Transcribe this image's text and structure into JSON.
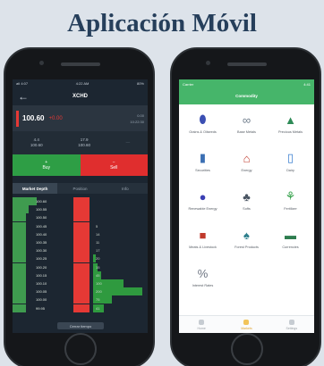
{
  "page_title": "Aplicación Móvil",
  "trade_screen": {
    "status_left": "atl 4:07",
    "status_time": "4:22 AM",
    "status_right": "80%",
    "ticker": "XCHD",
    "price": "100.60",
    "change": "+0.00",
    "price_meta_1": "0.00",
    "price_meta_2": "10:22:30",
    "stat_1_label": "4.4",
    "stat_1_value": "100.60",
    "stat_2_label": "17.9",
    "stat_2_value": "100.60",
    "buy_label": "Buy",
    "sell_label": "Sell",
    "tabs": [
      "Market Depth",
      "Position",
      "Info"
    ],
    "depth_rows": [
      {
        "bid": "100.60",
        "ask": "",
        "bid_fill": 0.18,
        "ask_fill": 0.0
      },
      {
        "bid": "100.55",
        "ask": "",
        "bid_fill": 0.12,
        "ask_fill": 0.0
      },
      {
        "bid": "100.50",
        "ask": "",
        "bid_fill": 0.1,
        "ask_fill": 0.0
      },
      {
        "bid": "100.45",
        "ask": "5",
        "bid_fill": 0.1,
        "ask_fill": 0.0
      },
      {
        "bid": "100.40",
        "ask": "14",
        "bid_fill": 0.1,
        "ask_fill": 0.0
      },
      {
        "bid": "100.35",
        "ask": "11",
        "bid_fill": 0.1,
        "ask_fill": 0.0
      },
      {
        "bid": "100.30",
        "ask": "17",
        "bid_fill": 0.1,
        "ask_fill": 0.0
      },
      {
        "bid": "100.25",
        "ask": "20",
        "bid_fill": 0.1,
        "ask_fill": 0.05
      },
      {
        "bid": "100.20",
        "ask": "15",
        "bid_fill": 0.1,
        "ask_fill": 0.08
      },
      {
        "bid": "100.15",
        "ask": "45",
        "bid_fill": 0.1,
        "ask_fill": 0.15
      },
      {
        "bid": "100.10",
        "ask": "100",
        "bid_fill": 0.1,
        "ask_fill": 0.55
      },
      {
        "bid": "100.05",
        "ask": "200",
        "bid_fill": 0.1,
        "ask_fill": 0.9
      },
      {
        "bid": "100.00",
        "ask": "75",
        "bid_fill": 0.1,
        "ask_fill": 0.35
      },
      {
        "bid": "99.95",
        "ask": "41",
        "bid_fill": 0.1,
        "ask_fill": 0.2
      }
    ],
    "close_button": "Cerrar tiempo"
  },
  "category_screen": {
    "status_left": "Carrier",
    "status_right": "4:41",
    "header_title": "Commodity",
    "categories": [
      {
        "label": "Grains & Oilseeds",
        "icon": "grain-icon",
        "color": "#3b4fb3"
      },
      {
        "label": "Base Metals",
        "icon": "chain-icon",
        "color": "#6f7d8c"
      },
      {
        "label": "Precious Metals",
        "icon": "gold-bars-icon",
        "color": "#2e8b57"
      },
      {
        "label": "Securities",
        "icon": "bar-chart-icon",
        "color": "#3b6fb3"
      },
      {
        "label": "Energy",
        "icon": "factory-icon",
        "color": "#c0392b"
      },
      {
        "label": "Dairy",
        "icon": "milk-icon",
        "color": "#3b7fd0"
      },
      {
        "label": "Renewable Energy",
        "icon": "leaf-drop-icon",
        "color": "#3b3fb3"
      },
      {
        "label": "Softs",
        "icon": "plant-icon",
        "color": "#4a5563"
      },
      {
        "label": "Fertilizer",
        "icon": "sprout-icon",
        "color": "#2e9e45"
      },
      {
        "label": "Meats & Livestock",
        "icon": "cow-icon",
        "color": "#c0392b"
      },
      {
        "label": "Forest Products",
        "icon": "tree-icon",
        "color": "#2d7f8c"
      },
      {
        "label": "Currencies",
        "icon": "banknote-icon",
        "color": "#2e7d4f"
      },
      {
        "label": "Interest Rates",
        "icon": "percent-icon",
        "color": "#6b7380"
      }
    ],
    "tabbar": [
      "Home",
      "Markets",
      "Settings"
    ]
  }
}
